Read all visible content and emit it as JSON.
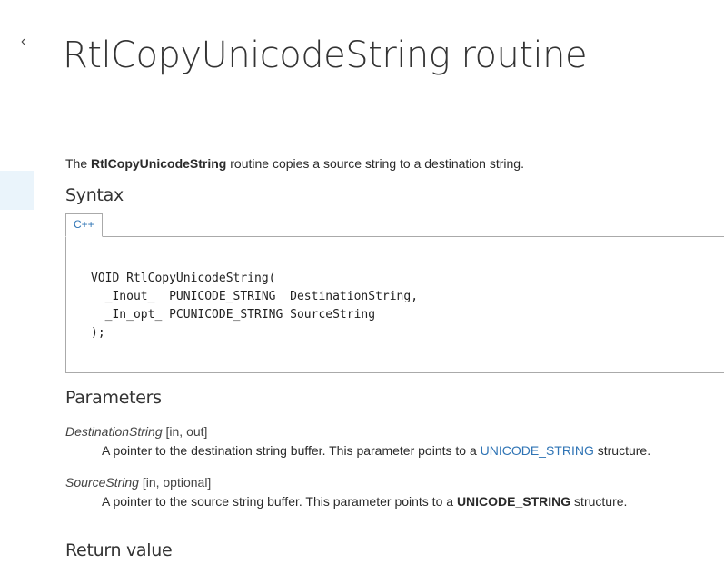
{
  "nav": {
    "back_glyph": "‹"
  },
  "page_title": "RtlCopyUnicodeString routine",
  "intro": {
    "prefix": "The ",
    "routine": "RtlCopyUnicodeString",
    "suffix": " routine copies a source string to a destination string."
  },
  "syntax": {
    "heading": "Syntax",
    "tab_label": "C++",
    "code_lines": [
      "VOID RtlCopyUnicodeString(",
      "  _Inout_  PUNICODE_STRING  DestinationString,",
      "  _In_opt_ PCUNICODE_STRING SourceString",
      ");"
    ]
  },
  "parameters": {
    "heading": "Parameters",
    "items": [
      {
        "name": "DestinationString",
        "qualifier": " [in, out]",
        "desc_prefix": "A pointer to the destination string buffer. This parameter points to a ",
        "link": "UNICODE_STRING",
        "desc_suffix": " structure."
      },
      {
        "name": "SourceString",
        "qualifier": " [in, optional]",
        "desc_prefix": "A pointer to the source string buffer. This parameter points to a ",
        "bold": "UNICODE_STRING",
        "desc_suffix": " structure."
      }
    ]
  },
  "return_value": {
    "heading": "Return value"
  }
}
